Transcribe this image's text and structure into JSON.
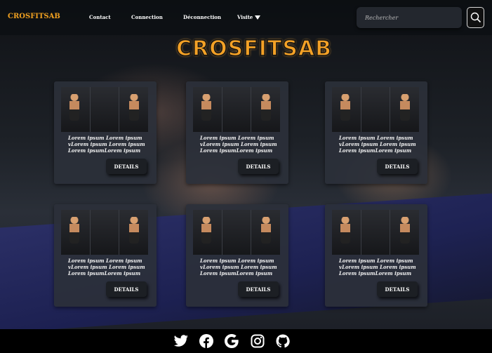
{
  "nav": {
    "brand": "CROSFITSAB",
    "links": [
      "Contact",
      "Connection",
      "Déconnection",
      "Visite"
    ],
    "search_placeholder": "Rechercher"
  },
  "hero": {
    "title": "CROSFITSAB"
  },
  "cards": [
    {
      "text": "Lorem ipsum Lorem ipsum\nvLorem ipsum Lorem ipsum\nLorem ipsumLorem ipsum",
      "button": "DETAILS"
    },
    {
      "text": "Lorem ipsum Lorem ipsum\nvLorem ipsum Lorem ipsum\nLorem ipsumLorem ipsum",
      "button": "DETAILS"
    },
    {
      "text": "Lorem ipsum Lorem ipsum\nvLorem ipsum Lorem ipsum\nLorem ipsumLorem ipsum",
      "button": "DETAILS"
    },
    {
      "text": "Lorem ipsum Lorem ipsum\nvLorem ipsum Lorem ipsum\nLorem ipsumLorem ipsum",
      "button": "DETAILS"
    },
    {
      "text": "Lorem ipsum Lorem ipsum\nvLorem ipsum Lorem ipsum\nLorem ipsumLorem ipsum",
      "button": "DETAILS"
    },
    {
      "text": "Lorem ipsum Lorem ipsum\nvLorem ipsum Lorem ipsum\nLorem ipsumLorem ipsum",
      "button": "DETAILS"
    }
  ],
  "footer": {
    "icons": [
      "twitter-icon",
      "facebook-icon",
      "google-icon",
      "instagram-icon",
      "github-icon"
    ]
  },
  "colors": {
    "accent": "#f3a126",
    "card_bg": "#2b303a",
    "footer_bg": "#000000"
  }
}
